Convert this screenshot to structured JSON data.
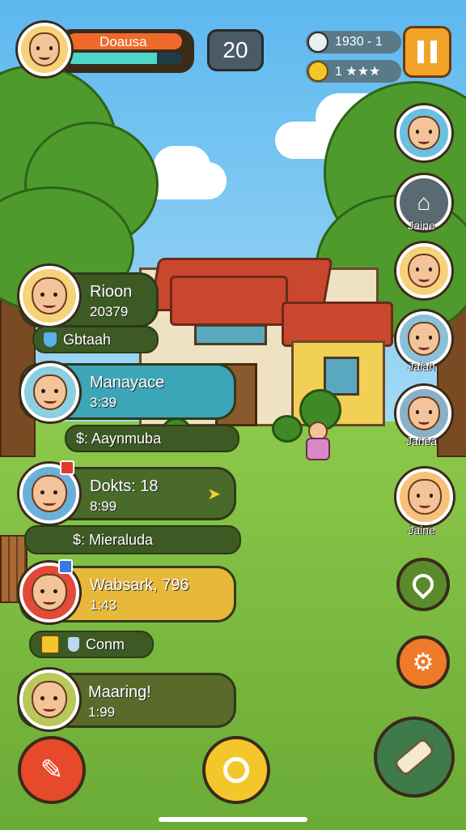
{
  "player": {
    "name": "Doausa",
    "level": "20",
    "xp_fraction": 0.78
  },
  "resources": {
    "coins": "1930 - 1",
    "stars": "1 ★★★"
  },
  "pause_icon": "pause-icon",
  "friends": [
    {
      "title": "Rioon",
      "subtitle": "20379",
      "color": "#3d5a24"
    },
    {
      "title": "Manayace",
      "subtitle": "3:39",
      "color": "#3da5b8"
    },
    {
      "title": "Dokts: 18",
      "subtitle": "8:99",
      "color": "#4a6a2a"
    },
    {
      "title": "Wabsark, 796",
      "subtitle": "1:43",
      "color": "#e8b83a"
    },
    {
      "title": "Maaring!",
      "subtitle": "1:99",
      "color": "#5a6a2a"
    }
  ],
  "strips": {
    "one": "Gbtaah",
    "two": "$: Aaynmuba",
    "three": "$: Mieraluda",
    "four": "Conm"
  },
  "neighbors": [
    "",
    "Jaine",
    "",
    "Jaian",
    "Janea",
    "Jaine"
  ],
  "buttons": {
    "left": "hammer-icon",
    "center": "search-icon",
    "right": "build-icon",
    "location": "location-pin-icon",
    "settings": "gear-icon"
  },
  "colors": {
    "accent_red": "#e64a2a",
    "accent_yellow": "#f3c72a",
    "accent_orange": "#ef7a2a",
    "hud_orange": "#ef6a2a"
  }
}
